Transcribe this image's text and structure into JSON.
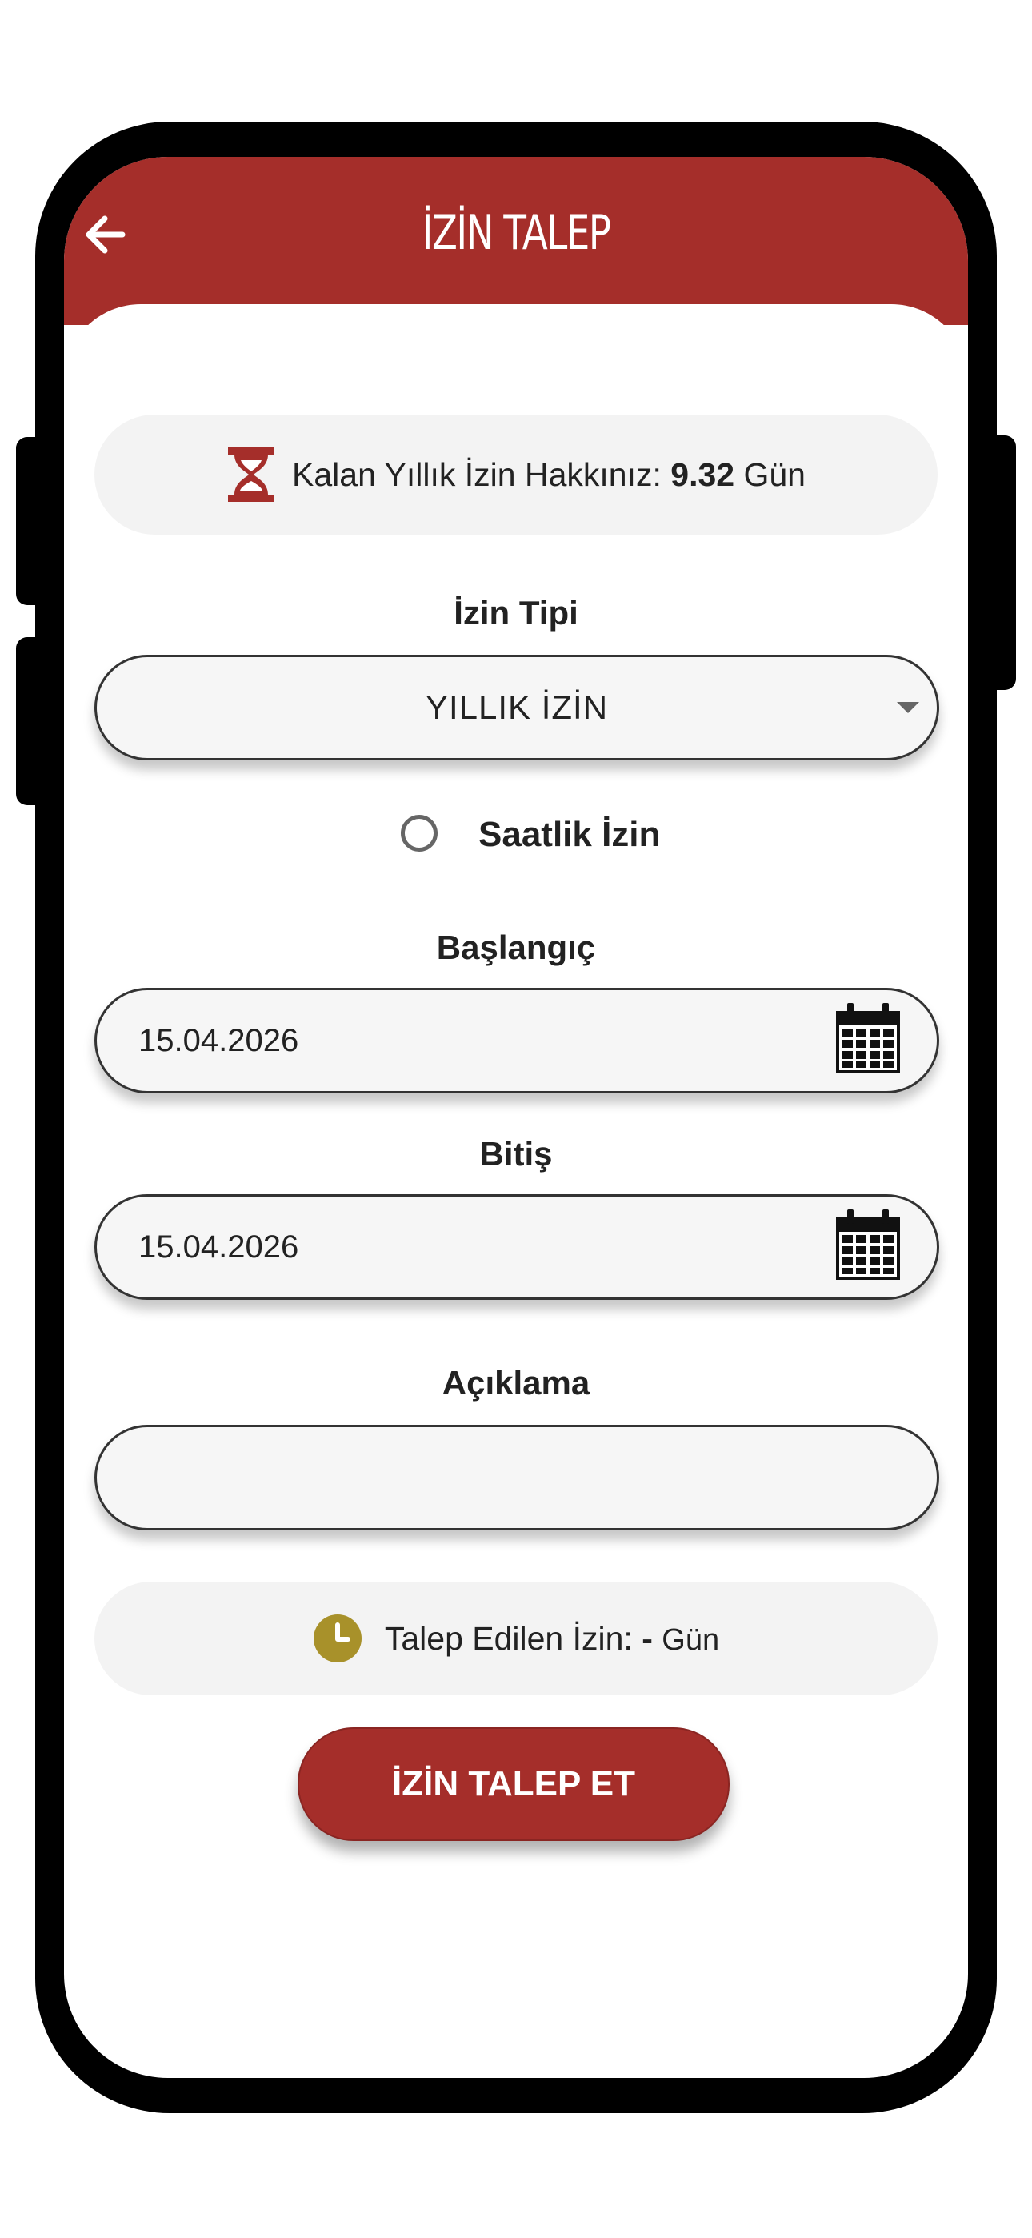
{
  "header": {
    "title": "İZİN TALEP"
  },
  "remaining": {
    "label": "Kalan Yıllık İzin Hakkınız:",
    "value": "9.32",
    "unit": "Gün"
  },
  "leave_type": {
    "label": "İzin Tipi",
    "selected": "YILLIK İZİN"
  },
  "hourly": {
    "label": "Saatlik İzin",
    "checked": false
  },
  "start": {
    "label": "Başlangıç",
    "value": "15.04.2026"
  },
  "end": {
    "label": "Bitiş",
    "value": "15.04.2026"
  },
  "description": {
    "label": "Açıklama",
    "value": ""
  },
  "requested": {
    "label": "Talep Edilen İzin:",
    "value": "-",
    "unit": "Gün"
  },
  "submit": {
    "label": "İZİN TALEP ET"
  },
  "colors": {
    "brand": "#A52E2A",
    "clock": "#A8912A",
    "card": "#F3F3F3"
  }
}
